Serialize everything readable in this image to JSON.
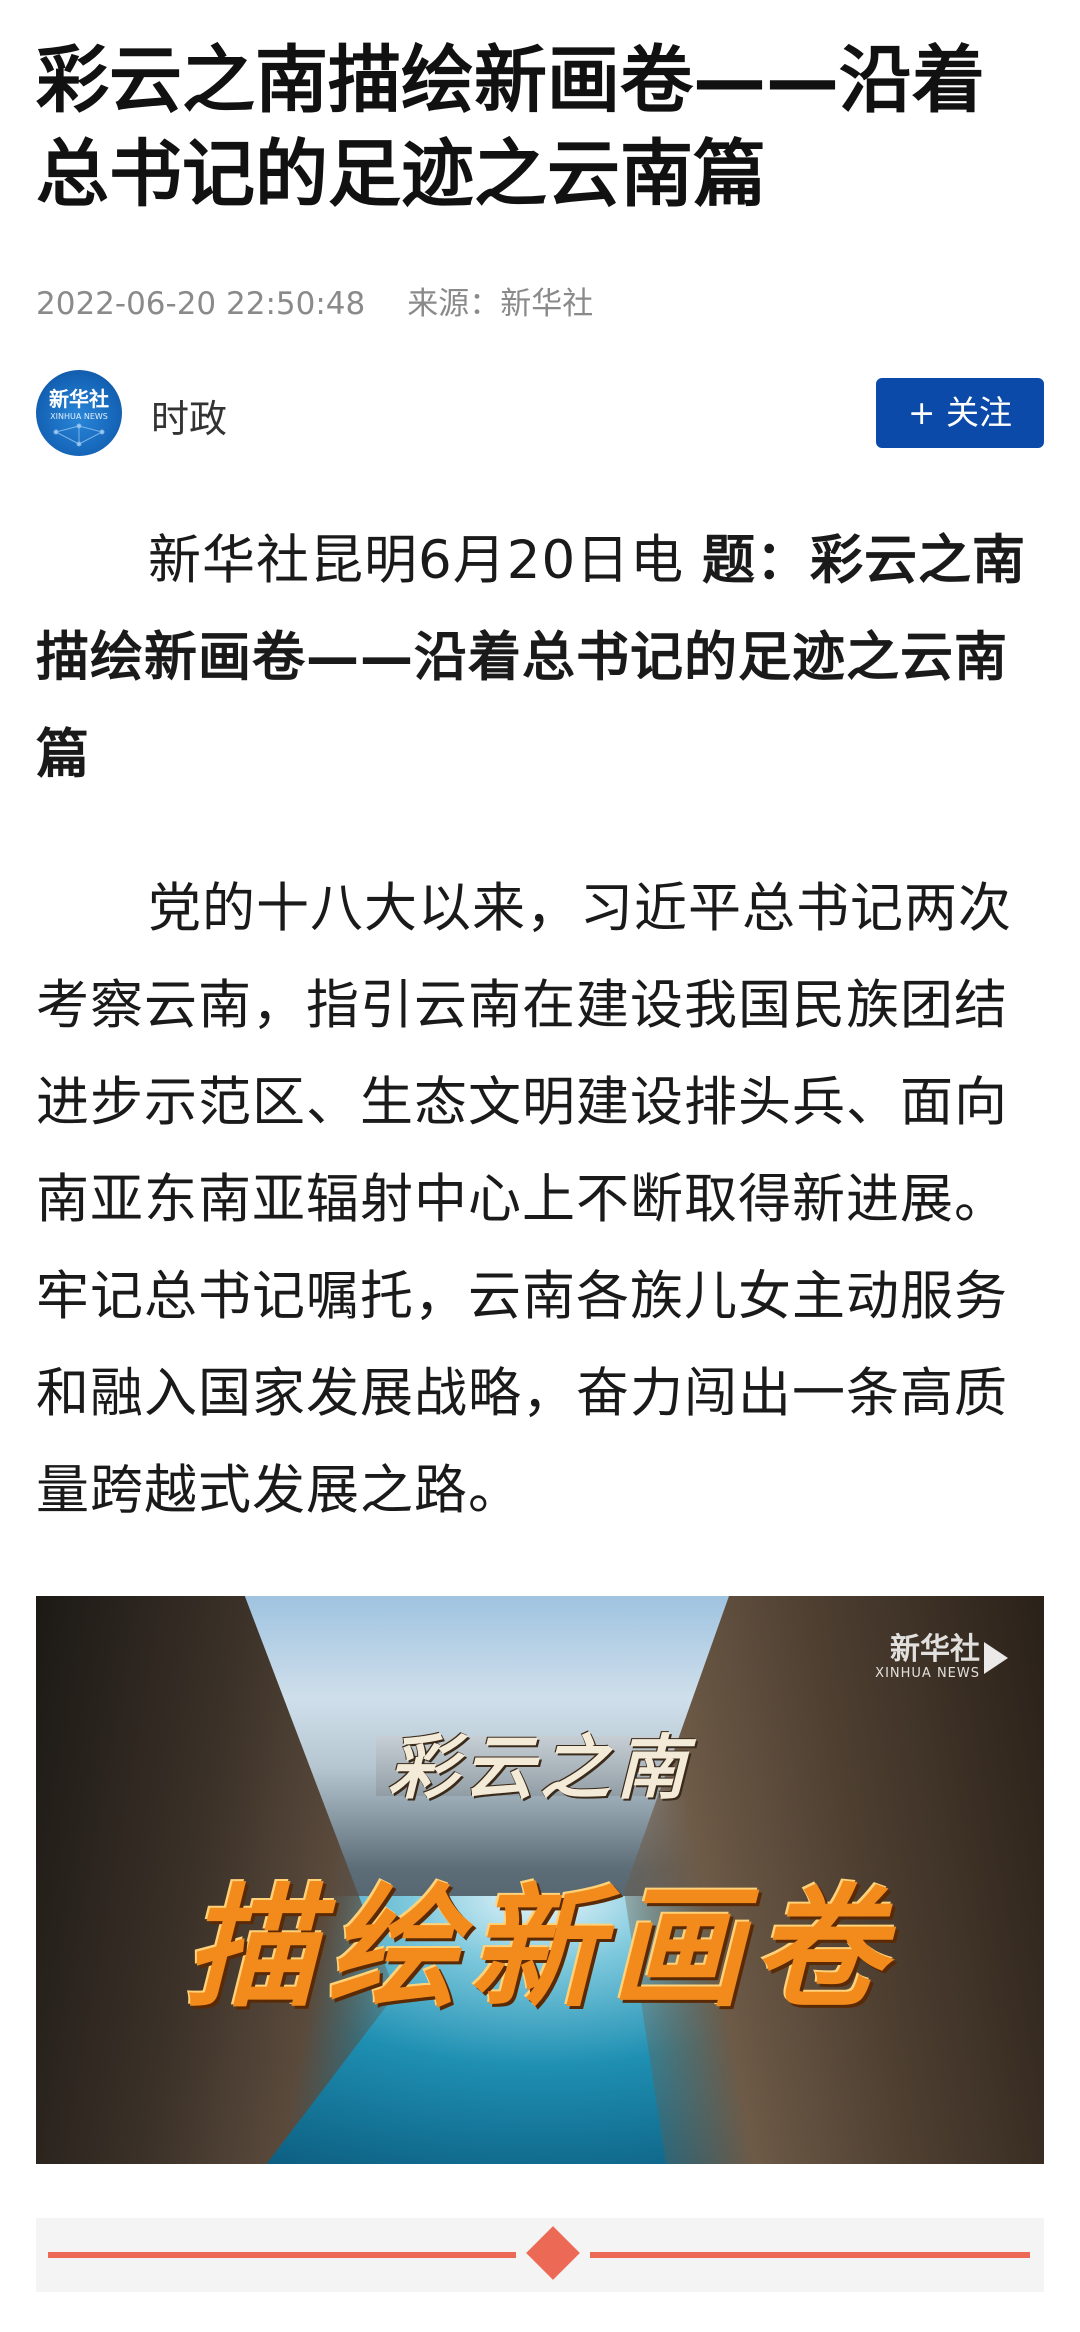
{
  "article": {
    "title": "彩云之南描绘新画卷——沿着总书记的足迹之云南篇",
    "date": "2022-06-20 22:50:48",
    "source": "来源：新华社"
  },
  "author": {
    "logo_text": "新华社",
    "logo_sub": "XINHUA NEWS",
    "channel": "时政",
    "follow_label": "+ 关注"
  },
  "body": {
    "para1_lead": "新华社昆明6月20日电 ",
    "para1_bold": "题：彩云之南描绘新画卷——沿着总书记的足迹之云南篇",
    "para2": "党的十八大以来，习近平总书记两次考察云南，指引云南在建设我国民族团结进步示范区、生态文明建设排头兵、面向南亚东南亚辐射中心上不断取得新进展。牢记总书记嘱托，云南各族儿女主动服务和融入国家发展战略，奋力闯出一条高质量跨越式发展之路。"
  },
  "image": {
    "caption_small": "彩云之南",
    "caption_big": "描绘新画卷",
    "watermark_cn": "新华社",
    "watermark_en": "XINHUA NEWS"
  },
  "colors": {
    "follow_button": "#0b4aa8",
    "divider_accent": "#ec6a55"
  }
}
